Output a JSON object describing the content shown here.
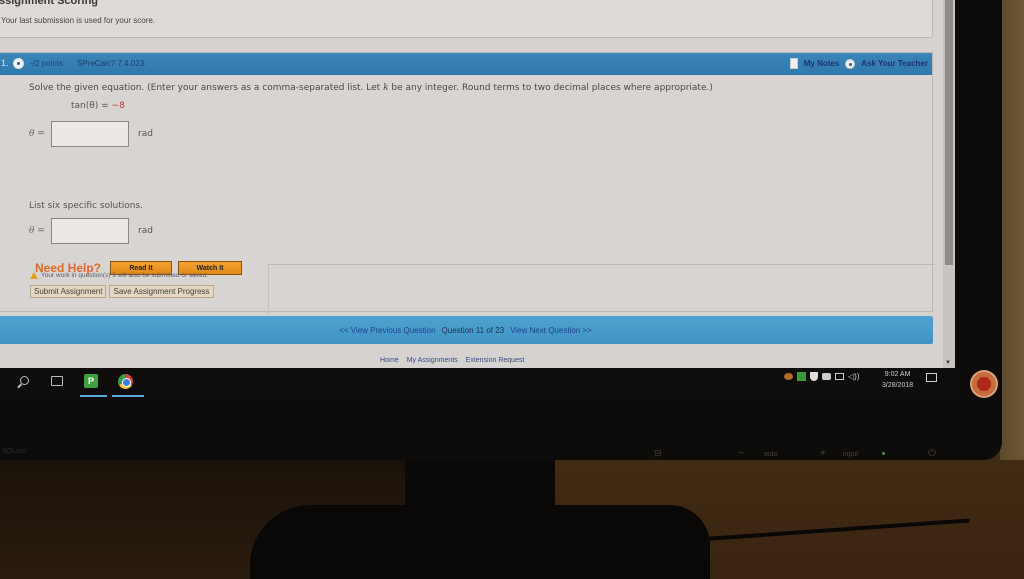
{
  "scoring": {
    "title": "ssignment Scoring",
    "text": "Your last submission is used for your score."
  },
  "question": {
    "number": "1.",
    "points": "-/2 points",
    "source": "SPreCalc7 7.4.023.",
    "my_notes": "My Notes",
    "ask_teacher": "Ask Your Teacher",
    "prompt_before_k": "Solve the given equation. (Enter your answers as a comma-separated list. Let ",
    "k": "k",
    "prompt_after_k": " be any integer. Round terms to two decimal places where appropriate.)",
    "equation_lhs": "tan(θ) = ",
    "equation_rhs": "−8",
    "answer1": {
      "label": "θ =",
      "value": "",
      "unit": "rad"
    },
    "list_prompt": "List six specific solutions.",
    "answer2": {
      "label": "θ =",
      "value": "",
      "unit": "rad"
    },
    "need_help": "Need Help?",
    "read_it": "Read It",
    "watch_it": "Watch It"
  },
  "submit": {
    "warning": "Your work in question(s) 9 will also be submitted or saved.",
    "submit_label": "Submit Assignment",
    "save_label": "Save Assignment Progress"
  },
  "nav": {
    "prev": "<< View Previous Question",
    "status": "Question 11 of 23",
    "next": "View Next Question >>"
  },
  "footer": {
    "home": "Home",
    "my_assignments": "My Assignments",
    "extension": "Extension Request"
  },
  "taskbar": {
    "icons": [
      "search-icon",
      "task-view-icon",
      "green-app-icon",
      "chrome-icon"
    ],
    "green_app_glyph": "P",
    "time": "9:02 AM",
    "date": "3/28/2018",
    "volume_glyph": "◁))"
  },
  "bezel": {
    "minus": "−",
    "auto": "auto",
    "plus": "+",
    "input": "input",
    "power": "⏻",
    "menu": "⊟",
    "brand": "SOLwm"
  }
}
